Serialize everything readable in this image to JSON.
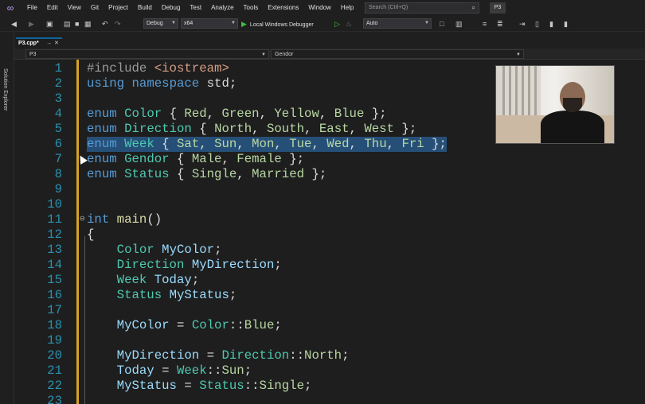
{
  "menu": {
    "items": [
      "File",
      "Edit",
      "View",
      "Git",
      "Project",
      "Build",
      "Debug",
      "Test",
      "Analyze",
      "Tools",
      "Extensions",
      "Window",
      "Help"
    ],
    "search_placeholder": "Search (Ctrl+Q)",
    "solution_name": "P3"
  },
  "toolbar": {
    "configuration": "Debug",
    "platform": "x64",
    "debugger": "Local Windows Debugger",
    "mode": "Auto"
  },
  "side_panel": {
    "label": "Solution Explorer"
  },
  "tab": {
    "filename": "P3.cpp*"
  },
  "navbar": {
    "project": "P3",
    "scope": "Gendor"
  },
  "editor": {
    "lines": [
      {
        "n": "1",
        "tokens": [
          [
            "pp",
            "#include "
          ],
          [
            "inc",
            "<iostream>"
          ]
        ]
      },
      {
        "n": "2",
        "tokens": [
          [
            "kw",
            "using"
          ],
          [
            "plain",
            " "
          ],
          [
            "kw",
            "namespace"
          ],
          [
            "plain",
            " std;"
          ]
        ]
      },
      {
        "n": "3",
        "tokens": []
      },
      {
        "n": "4",
        "tokens": [
          [
            "kw",
            "enum"
          ],
          [
            "plain",
            " "
          ],
          [
            "ty",
            "Color"
          ],
          [
            "plain",
            " { "
          ],
          [
            "en",
            "Red"
          ],
          [
            "plain",
            ", "
          ],
          [
            "en",
            "Green"
          ],
          [
            "plain",
            ", "
          ],
          [
            "en",
            "Yellow"
          ],
          [
            "plain",
            ", "
          ],
          [
            "en",
            "Blue"
          ],
          [
            "plain",
            " };"
          ]
        ]
      },
      {
        "n": "5",
        "tokens": [
          [
            "kw",
            "enum"
          ],
          [
            "plain",
            " "
          ],
          [
            "ty",
            "Direction"
          ],
          [
            "plain",
            " { "
          ],
          [
            "en",
            "North"
          ],
          [
            "plain",
            ", "
          ],
          [
            "en",
            "South"
          ],
          [
            "plain",
            ", "
          ],
          [
            "en",
            "East"
          ],
          [
            "plain",
            ", "
          ],
          [
            "en",
            "West"
          ],
          [
            "plain",
            " };"
          ]
        ]
      },
      {
        "n": "6",
        "highlight": true,
        "tokens": [
          [
            "kw",
            "enum"
          ],
          [
            "plain",
            " "
          ],
          [
            "ty",
            "Week"
          ],
          [
            "plain",
            " { "
          ],
          [
            "en",
            "Sat"
          ],
          [
            "plain",
            ", "
          ],
          [
            "en",
            "Sun"
          ],
          [
            "plain",
            ", "
          ],
          [
            "en",
            "Mon"
          ],
          [
            "plain",
            ", "
          ],
          [
            "en",
            "Tue"
          ],
          [
            "plain",
            ", "
          ],
          [
            "en",
            "Wed"
          ],
          [
            "plain",
            ", "
          ],
          [
            "en",
            "Thu"
          ],
          [
            "plain",
            ", "
          ],
          [
            "en",
            "Fri"
          ],
          [
            "plain",
            " };"
          ]
        ]
      },
      {
        "n": "7",
        "tokens": [
          [
            "kw",
            "enum"
          ],
          [
            "plain",
            " "
          ],
          [
            "ty",
            "Gendor"
          ],
          [
            "plain",
            " { "
          ],
          [
            "en",
            "Male"
          ],
          [
            "plain",
            ", "
          ],
          [
            "en",
            "Female"
          ],
          [
            "plain",
            " };"
          ]
        ]
      },
      {
        "n": "8",
        "tokens": [
          [
            "kw",
            "enum"
          ],
          [
            "plain",
            " "
          ],
          [
            "ty",
            "Status"
          ],
          [
            "plain",
            " { "
          ],
          [
            "en",
            "Single"
          ],
          [
            "plain",
            ", "
          ],
          [
            "en",
            "Married"
          ],
          [
            "plain",
            " };"
          ]
        ]
      },
      {
        "n": "9",
        "tokens": []
      },
      {
        "n": "10",
        "tokens": []
      },
      {
        "n": "11",
        "fold": true,
        "tokens": [
          [
            "kw",
            "int"
          ],
          [
            "plain",
            " "
          ],
          [
            "fn",
            "main"
          ],
          [
            "plain",
            "()"
          ]
        ]
      },
      {
        "n": "12",
        "tokens": [
          [
            "plain",
            "{"
          ]
        ]
      },
      {
        "n": "13",
        "tokens": [
          [
            "plain",
            "    "
          ],
          [
            "ty",
            "Color"
          ],
          [
            "plain",
            " "
          ],
          [
            "var",
            "MyColor"
          ],
          [
            "plain",
            ";"
          ]
        ]
      },
      {
        "n": "14",
        "tokens": [
          [
            "plain",
            "    "
          ],
          [
            "ty",
            "Direction"
          ],
          [
            "plain",
            " "
          ],
          [
            "var",
            "MyDirection"
          ],
          [
            "plain",
            ";"
          ]
        ]
      },
      {
        "n": "15",
        "tokens": [
          [
            "plain",
            "    "
          ],
          [
            "ty",
            "Week"
          ],
          [
            "plain",
            " "
          ],
          [
            "var",
            "Today"
          ],
          [
            "plain",
            ";"
          ]
        ]
      },
      {
        "n": "16",
        "tokens": [
          [
            "plain",
            "    "
          ],
          [
            "ty",
            "Status"
          ],
          [
            "plain",
            " "
          ],
          [
            "var",
            "MyStatus"
          ],
          [
            "plain",
            ";"
          ]
        ]
      },
      {
        "n": "17",
        "tokens": []
      },
      {
        "n": "18",
        "tokens": [
          [
            "plain",
            "    "
          ],
          [
            "var",
            "MyColor"
          ],
          [
            "plain",
            " = "
          ],
          [
            "ty",
            "Color"
          ],
          [
            "plain",
            "::"
          ],
          [
            "en",
            "Blue"
          ],
          [
            "plain",
            ";"
          ]
        ]
      },
      {
        "n": "19",
        "tokens": []
      },
      {
        "n": "20",
        "tokens": [
          [
            "plain",
            "    "
          ],
          [
            "var",
            "MyDirection"
          ],
          [
            "plain",
            " = "
          ],
          [
            "ty",
            "Direction"
          ],
          [
            "plain",
            "::"
          ],
          [
            "en",
            "North"
          ],
          [
            "plain",
            ";"
          ]
        ]
      },
      {
        "n": "21",
        "tokens": [
          [
            "plain",
            "    "
          ],
          [
            "var",
            "Today"
          ],
          [
            "plain",
            " = "
          ],
          [
            "ty",
            "Week"
          ],
          [
            "plain",
            "::"
          ],
          [
            "en",
            "Sun"
          ],
          [
            "plain",
            ";"
          ]
        ]
      },
      {
        "n": "22",
        "tokens": [
          [
            "plain",
            "    "
          ],
          [
            "var",
            "MyStatus"
          ],
          [
            "plain",
            " = "
          ],
          [
            "ty",
            "Status"
          ],
          [
            "plain",
            "::"
          ],
          [
            "en",
            "Single"
          ],
          [
            "plain",
            ";"
          ]
        ]
      },
      {
        "n": "23",
        "tokens": []
      }
    ]
  },
  "colors": {
    "accent_gutter": "#d7a320",
    "selection": "#264f78",
    "keyword": "#569cd6",
    "type": "#4ec9b0",
    "enumerator": "#b8d7a3"
  }
}
